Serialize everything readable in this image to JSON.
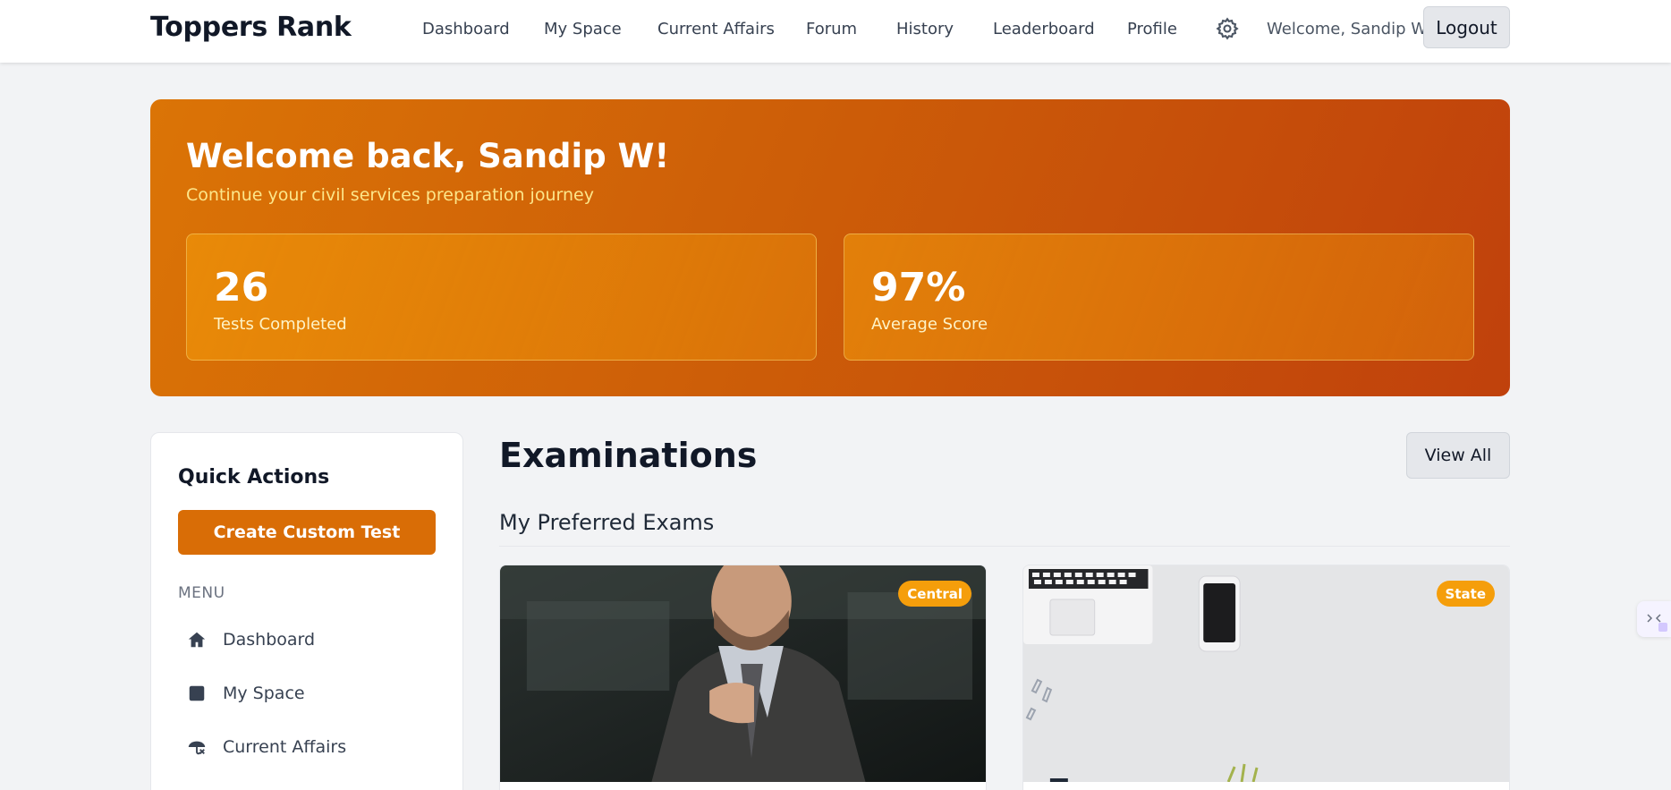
{
  "header": {
    "brand": "Toppers Rank",
    "nav": [
      "Dashboard",
      "My Space",
      "Current Affairs",
      "Forum",
      "History",
      "Leaderboard",
      "Profile"
    ],
    "settings_icon": "gear-icon",
    "welcome": "Welcome, Sandip W",
    "logout": "Logout"
  },
  "hero": {
    "title": "Welcome back, Sandip W!",
    "subtitle": "Continue your civil services preparation journey",
    "stats": [
      {
        "value": "26",
        "label": "Tests Completed"
      },
      {
        "value": "97%",
        "label": "Average Score"
      }
    ]
  },
  "sidebar": {
    "title": "Quick Actions",
    "create_button": "Create Custom Test",
    "menu_label": "MENU",
    "items": [
      {
        "label": "Dashboard",
        "icon": "home-icon"
      },
      {
        "label": "My Space",
        "icon": "square-icon"
      },
      {
        "label": "Current Affairs",
        "icon": "umbrella-icon"
      }
    ]
  },
  "main": {
    "title": "Examinations",
    "view_all": "View All",
    "section": "My Preferred Exams",
    "cards": [
      {
        "badge": "Central"
      },
      {
        "badge": "State"
      }
    ]
  },
  "colors": {
    "accent": "#d96d06",
    "badge": "#f59e0b",
    "hero_start": "#db7406",
    "hero_end": "#c0410c"
  }
}
